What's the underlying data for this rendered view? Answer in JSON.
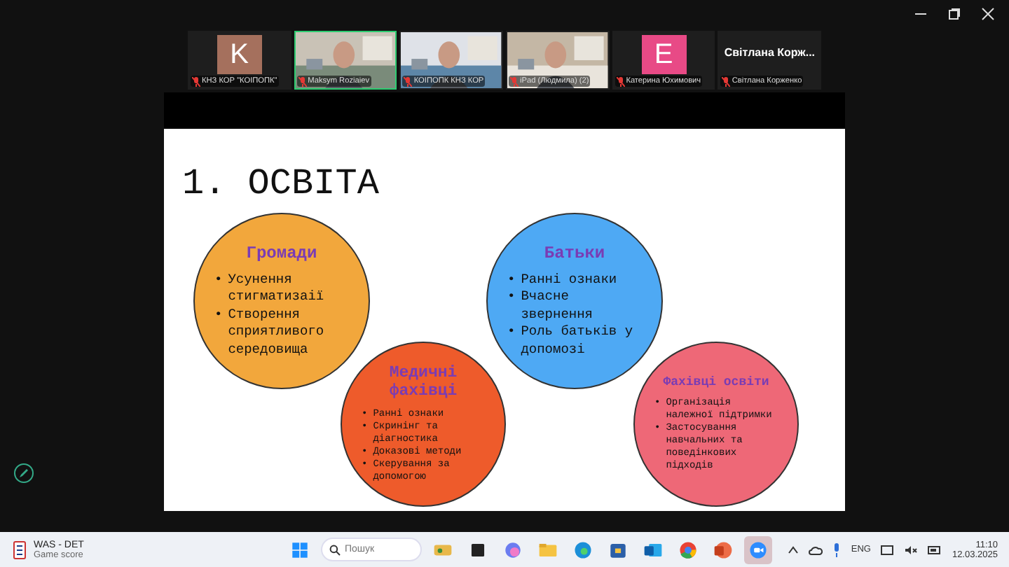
{
  "participants": [
    {
      "kind": "avatar",
      "initial": "K",
      "color": "#a5705d",
      "name": "КНЗ КОР \"КОІПОПК\"",
      "speaking": false,
      "muted": true
    },
    {
      "kind": "video",
      "name": "Maksym Roziaiev",
      "speaking": true,
      "muted": true
    },
    {
      "kind": "video",
      "name": "КОІПОПК КНЗ КОР",
      "speaking": false,
      "muted": true
    },
    {
      "kind": "video",
      "name": "iPad (Людмила) (2)",
      "speaking": false,
      "muted": true
    },
    {
      "kind": "avatar",
      "initial": "E",
      "color": "#e84a86",
      "name": "Катерина Юхимович",
      "speaking": false,
      "muted": true
    },
    {
      "kind": "name",
      "display": "Світлана Корж...",
      "name": "Світлана Корженко",
      "speaking": false,
      "muted": true
    }
  ],
  "slide": {
    "title": "1. ОСВІТА",
    "circles": [
      {
        "heading": "Громади",
        "color": "#f2a73c",
        "marker": "•",
        "bullets": [
          "Усунення стигматизаії",
          "Створення сприятливого середовища"
        ]
      },
      {
        "heading": "Медичні фахівці",
        "color": "#ee5b2b",
        "marker": "•",
        "bullets": [
          "Ранні ознаки",
          "Скринінг та діагностика",
          "Доказові методи",
          "Скерування за допомогою"
        ]
      },
      {
        "heading": "Батьки",
        "color": "#4ea9f4",
        "marker": "•",
        "bullets": [
          "Ранні ознаки",
          "Вчасне звернення",
          "Роль батьків у допомозі"
        ]
      },
      {
        "heading": "Фахівці освіти",
        "color": "#ee6877",
        "marker": "•",
        "bullets": [
          "Організація належної підтримки",
          "Застосування навчальних та поведінкових підходів"
        ]
      }
    ]
  },
  "taskbar": {
    "widget": {
      "title": "WAS - DET",
      "subtitle": "Game score"
    },
    "search": {
      "placeholder": "Пошук"
    },
    "apps": [
      {
        "kind": "windows",
        "active": false
      },
      {
        "kind": "widgets",
        "active": false
      },
      {
        "kind": "taskview",
        "active": false
      },
      {
        "kind": "copilot",
        "active": false
      },
      {
        "kind": "folder",
        "active": false
      },
      {
        "kind": "edge",
        "active": false
      },
      {
        "kind": "store",
        "active": false
      },
      {
        "kind": "outlook",
        "active": false
      },
      {
        "kind": "chrome",
        "active": false
      },
      {
        "kind": "powerpoint",
        "active": false
      },
      {
        "kind": "zoom",
        "active": true
      }
    ],
    "language": "ENG",
    "time": "11:10",
    "date": "12.03.2025"
  }
}
